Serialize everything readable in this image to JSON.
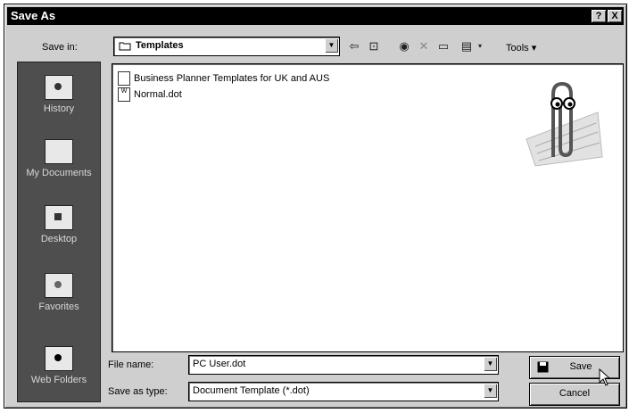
{
  "window": {
    "title": "Save As",
    "help_btn": "?",
    "close_btn": "X"
  },
  "toolbar": {
    "save_in_label": "Save in:",
    "save_in_value": "Templates",
    "tools_label": "Tools",
    "icons": [
      "back-icon",
      "up-folder-icon",
      "search-web-icon",
      "delete-icon",
      "new-folder-icon",
      "views-icon"
    ]
  },
  "places": [
    {
      "label": "History"
    },
    {
      "label": "My Documents"
    },
    {
      "label": "Desktop"
    },
    {
      "label": "Favorites"
    },
    {
      "label": "Web Folders"
    }
  ],
  "files": [
    {
      "name": "Business Planner Templates for UK and AUS",
      "icon": "folder-doc-icon"
    },
    {
      "name": "Normal.dot",
      "icon": "word-template-icon"
    }
  ],
  "form": {
    "file_name_label": "File name:",
    "file_name_value": "PC User.dot",
    "save_type_label": "Save as type:",
    "save_type_value": "Document Template (*.dot)"
  },
  "buttons": {
    "save": "Save",
    "cancel": "Cancel"
  }
}
